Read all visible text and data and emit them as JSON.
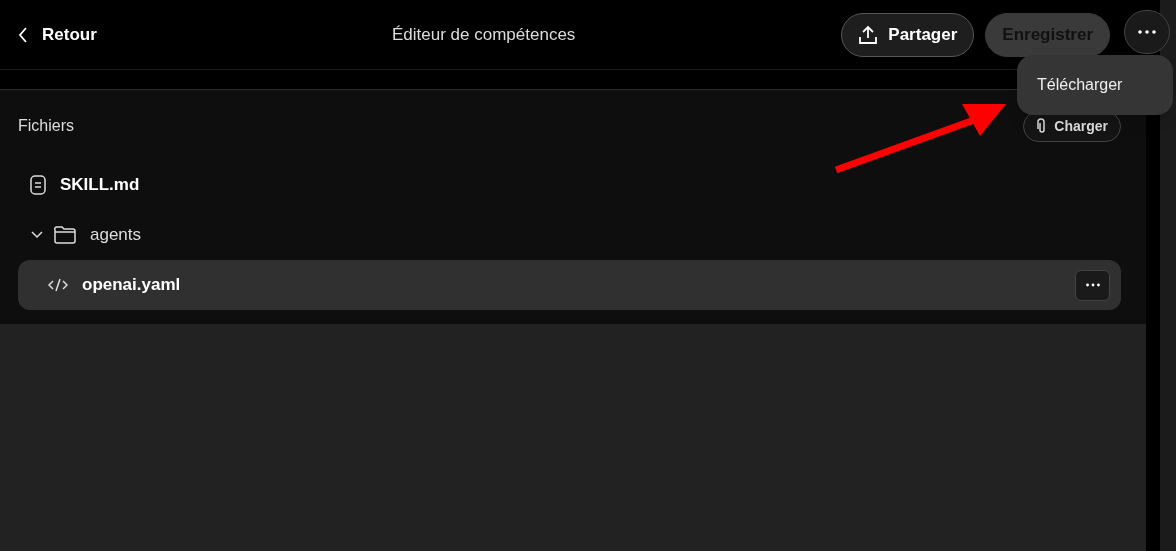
{
  "header": {
    "back": "Retour",
    "title": "Éditeur de compétences",
    "buttons": [
      {
        "label": "Partager",
        "kind": "share",
        "disabled": false
      },
      {
        "label": "Enregistrer",
        "kind": "plain",
        "disabled": true
      }
    ]
  },
  "menu": {
    "items": [
      "Télécharger"
    ]
  },
  "files": {
    "title": "Fichiers",
    "upload": "Charger",
    "tree": [
      {
        "name": "SKILL.md",
        "kind": "file",
        "selected": false
      },
      {
        "name": "agents",
        "kind": "folder",
        "expanded": true,
        "selected": false,
        "children": [
          {
            "name": "openai.yaml",
            "kind": "code",
            "selected": true
          }
        ]
      }
    ]
  }
}
